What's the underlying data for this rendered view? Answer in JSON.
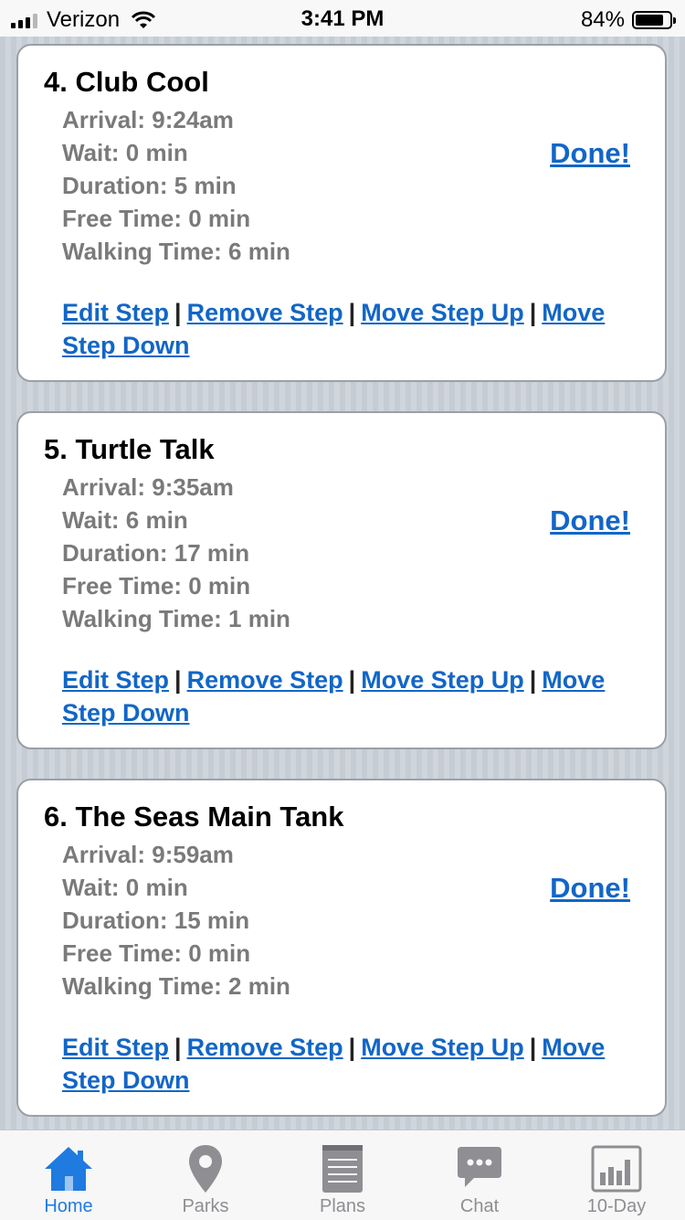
{
  "status_bar": {
    "carrier": "Verizon",
    "time": "3:41 PM",
    "battery": "84%",
    "battery_level": 0.84
  },
  "steps": [
    {
      "title": "4. Club Cool",
      "arrival": "Arrival: 9:24am",
      "wait": "Wait: 0 min",
      "duration": "Duration: 5 min",
      "free_time": "Free Time: 0 min",
      "walking_time": "Walking Time: 6 min",
      "done_label": "Done!"
    },
    {
      "title": "5. Turtle Talk",
      "arrival": "Arrival: 9:35am",
      "wait": "Wait: 6 min",
      "duration": "Duration: 17 min",
      "free_time": "Free Time: 0 min",
      "walking_time": "Walking Time: 1 min",
      "done_label": "Done!"
    },
    {
      "title": "6. The Seas Main Tank",
      "arrival": "Arrival: 9:59am",
      "wait": "Wait: 0 min",
      "duration": "Duration: 15 min",
      "free_time": "Free Time: 0 min",
      "walking_time": "Walking Time: 2 min",
      "done_label": "Done!"
    }
  ],
  "step_actions": {
    "edit": "Edit Step",
    "remove": "Remove Step",
    "move_up": "Move Step Up",
    "move_down": "Move Step Down",
    "separator": "|"
  },
  "tabs": [
    {
      "label": "Home",
      "icon": "home-icon",
      "active": true
    },
    {
      "label": "Parks",
      "icon": "map-pin-icon",
      "active": false
    },
    {
      "label": "Plans",
      "icon": "notepad-icon",
      "active": false
    },
    {
      "label": "Chat",
      "icon": "chat-bubble-icon",
      "active": false
    },
    {
      "label": "10-Day",
      "icon": "bar-chart-icon",
      "active": false
    }
  ],
  "colors": {
    "link": "#1266c7",
    "active_tab": "#1f7be0",
    "inactive_tab": "#8e8e93",
    "detail_text": "#7a7a7a"
  }
}
